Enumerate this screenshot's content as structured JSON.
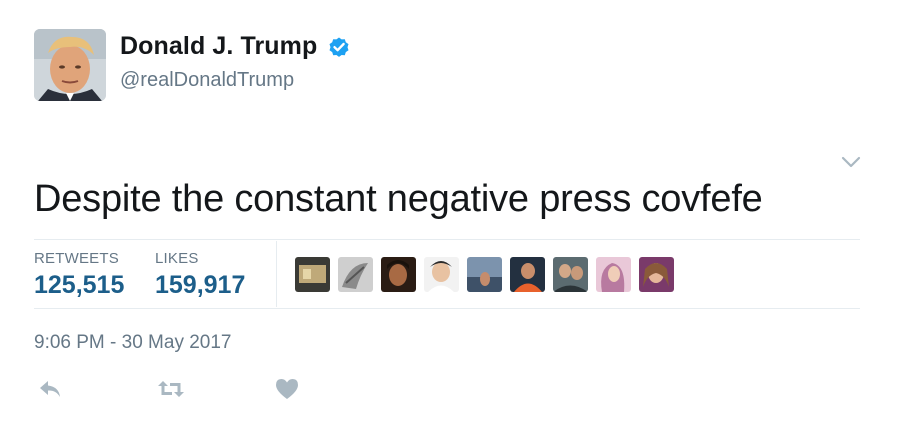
{
  "author": {
    "display_name": "Donald J. Trump",
    "handle": "@realDonaldTrump",
    "verified": true
  },
  "tweet": {
    "text": "Despite the constant negative press covfefe",
    "timestamp": "9:06 PM - 30 May 2017"
  },
  "stats": {
    "retweets_label": "RETWEETS",
    "retweets_count": "125,515",
    "likes_label": "LIKES",
    "likes_count": "159,917"
  },
  "likers_count_shown": 9,
  "actions": {
    "reply_icon": "reply-icon",
    "retweet_icon": "retweet-icon",
    "like_icon": "heart-icon"
  },
  "colors": {
    "verified_blue": "#1da1f2",
    "stat_value": "#1c5e8a",
    "secondary_text": "#657786",
    "action_icon": "#aab8c2"
  }
}
